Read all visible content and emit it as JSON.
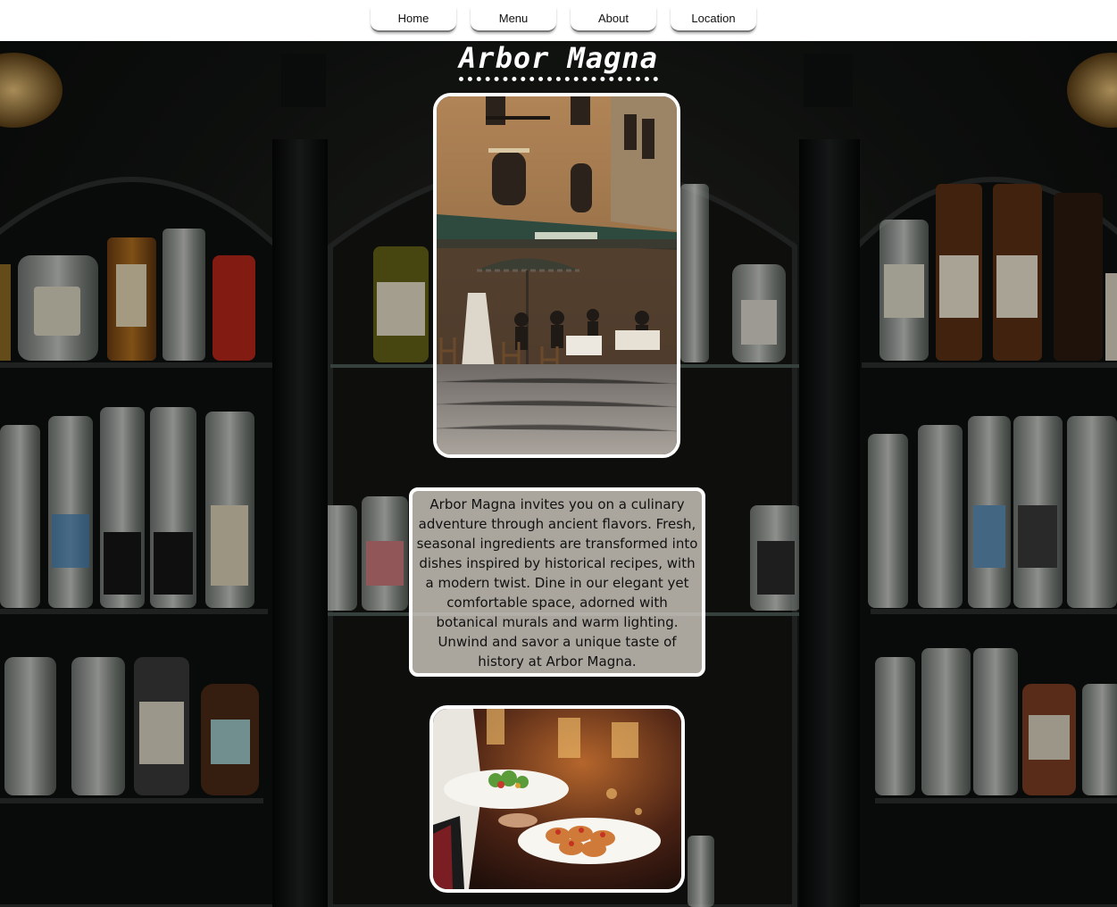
{
  "nav": {
    "items": [
      {
        "label": "Home"
      },
      {
        "label": "Menu"
      },
      {
        "label": "About"
      },
      {
        "label": "Location"
      }
    ]
  },
  "header": {
    "title": "Arbor Magna"
  },
  "about": {
    "text": "Arbor Magna invites you on a culinary adventure through ancient flavors. Fresh, seasonal ingredients are transformed into dishes inspired by historical recipes, with a modern twist. Dine in our elegant yet comfortable space, adorned with botanical murals and warm lighting. Unwind and savor a unique taste of history at Arbor Magna."
  },
  "colors": {
    "nav_background": "#ffffff",
    "title": "#ffffff",
    "card_border": "#ffffff",
    "about_box_background": "#cdc8be"
  }
}
